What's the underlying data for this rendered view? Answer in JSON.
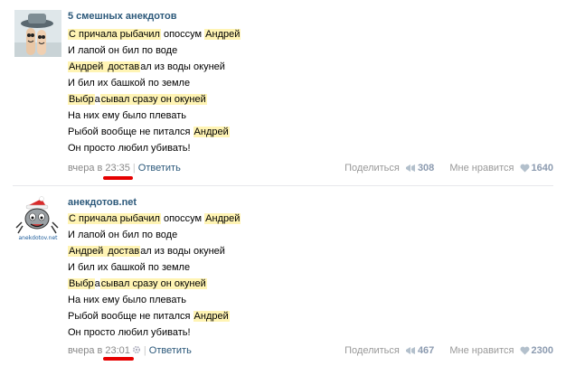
{
  "posts": [
    {
      "author": "5 смешных анекдотов",
      "lines": [
        [
          "",
          "С причала рыбачил",
          " опоссум ",
          "Андрей",
          ""
        ],
        [
          "И лапой он бил по воде",
          "",
          "",
          "",
          ""
        ],
        [
          "",
          "Андрей",
          " достав",
          "ал",
          " из воды окуней"
        ],
        [
          "И бил их башкой по земле",
          "",
          "",
          "",
          ""
        ],
        [
          "Выбр",
          "а",
          "сывал сразу он окуней",
          "",
          ""
        ],
        [
          "На них ему было плевать",
          "",
          "",
          "",
          ""
        ],
        [
          "Рыбой вообще не питался ",
          "Андрей",
          "",
          "",
          ""
        ],
        [
          "Он просто любил убивать!",
          "",
          "",
          "",
          ""
        ]
      ],
      "meta": {
        "prefix": "вчера в ",
        "time": "23:35",
        "sep": "|",
        "reply": "Ответить"
      },
      "share": {
        "label": "Поделиться",
        "count": "308"
      },
      "like": {
        "label": "Мне нравится",
        "count": "1640"
      }
    },
    {
      "author": "анекдотов.net",
      "lines": [
        [
          "",
          "С причала рыбачил",
          " опоссум ",
          "Андрей",
          ""
        ],
        [
          "И лапой он бил по воде",
          "",
          "",
          "",
          ""
        ],
        [
          "",
          "Андрей",
          " достав",
          "ал",
          " из воды окуней"
        ],
        [
          "И бил их башкой по земле",
          "",
          "",
          "",
          ""
        ],
        [
          "Выбр",
          "а",
          "сывал сразу он окуней",
          "",
          ""
        ],
        [
          "На них ему было плевать",
          "",
          "",
          "",
          ""
        ],
        [
          "Рыбой вообще не питался ",
          "Андрей",
          "",
          "",
          ""
        ],
        [
          "Он просто любил убивать!",
          "",
          "",
          "",
          ""
        ]
      ],
      "meta": {
        "prefix": "вчера в ",
        "time": "23:01",
        "sep": "|",
        "reply": "Ответить"
      },
      "share": {
        "label": "Поделиться",
        "count": "467"
      },
      "like": {
        "label": "Мне нравится",
        "count": "2300"
      }
    }
  ],
  "avatar2_text": "anekdotov.net",
  "colors": {
    "link": "#2b587a",
    "highlight": "#fff4b4",
    "underline": "#e60000",
    "muted": "#888888"
  }
}
